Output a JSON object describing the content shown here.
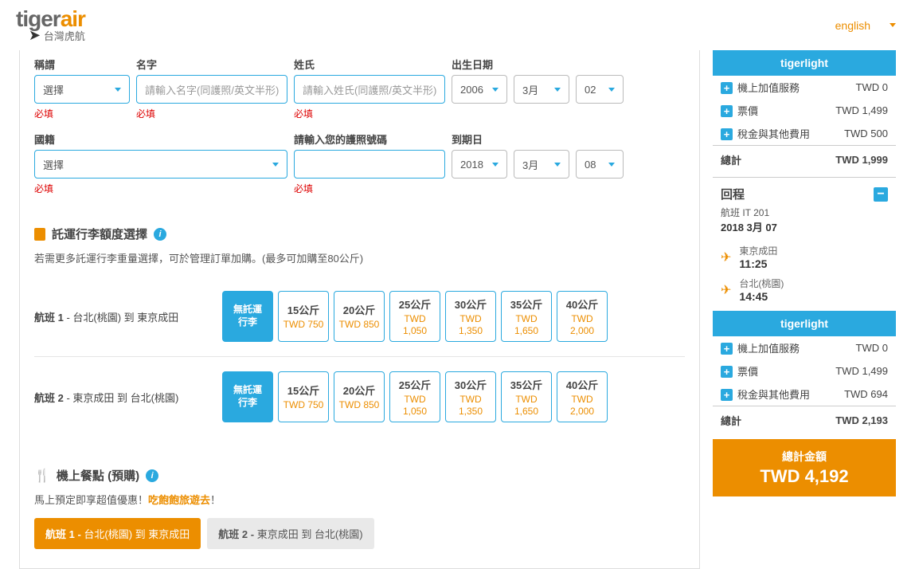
{
  "header": {
    "brand_main_1": "tiger",
    "brand_main_2": "air",
    "brand_sub": "台灣虎航",
    "lang": "english"
  },
  "form": {
    "title_label": "稱謂",
    "title_value": "選擇",
    "first_label": "名字",
    "first_ph": "請輸入名字(同護照/英文半形)",
    "last_label": "姓氏",
    "last_ph": "請輸入姓氏(同護照/英文半形)",
    "dob_label": "出生日期",
    "dob_y": "2006",
    "dob_m": "3月",
    "dob_d": "02",
    "nat_label": "國籍",
    "nat_value": "選擇",
    "pass_label": "請輸入您的護照號碼",
    "exp_label": "到期日",
    "exp_y": "2018",
    "exp_m": "3月",
    "exp_d": "08",
    "required": "必填"
  },
  "baggage": {
    "heading": "託運行李額度選擇",
    "note": "若需更多託運行李重量選擇，可於管理訂單加購。(最多可加購至80公斤)",
    "leg1_prefix": "航班 1",
    "leg1_route": " - 台北(桃園) 到 東京成田",
    "leg2_prefix": "航班 2",
    "leg2_route": " - 東京成田 到 台北(桃園)",
    "none": "無託運行李",
    "opts": [
      {
        "kg": "15公斤",
        "price": "TWD 750"
      },
      {
        "kg": "20公斤",
        "price": "TWD 850"
      },
      {
        "kg": "25公斤",
        "price": "TWD 1,050"
      },
      {
        "kg": "30公斤",
        "price": "TWD 1,350"
      },
      {
        "kg": "35公斤",
        "price": "TWD 1,650"
      },
      {
        "kg": "40公斤",
        "price": "TWD 2,000"
      }
    ]
  },
  "meals": {
    "heading": "機上餐點 (預購)",
    "note_a": "馬上預定即享超值優惠！",
    "note_b": "吃飽飽旅遊去",
    "note_c": "！",
    "tab1_prefix": "航班 1 - ",
    "tab1_route": "台北(桃園) 到 東京成田",
    "tab2_prefix": "航班 2 - ",
    "tab2_route": "東京成田 到 台北(桃園)"
  },
  "summary1": {
    "band": "tigerlight",
    "rows": [
      {
        "label": "機上加值服務",
        "value": "TWD 0"
      },
      {
        "label": "票價",
        "value": "TWD 1,499"
      },
      {
        "label": "稅金與其他費用",
        "value": "TWD 500"
      }
    ],
    "total_label": "總計",
    "total_value": "TWD 1,999"
  },
  "return": {
    "title": "回程",
    "flight": "航班 IT 201",
    "date": "2018 3月 07",
    "dep_city": "東京成田",
    "dep_time": "11:25",
    "arr_city": "台北(桃園)",
    "arr_time": "14:45"
  },
  "summary2": {
    "band": "tigerlight",
    "rows": [
      {
        "label": "機上加值服務",
        "value": "TWD 0"
      },
      {
        "label": "票價",
        "value": "TWD 1,499"
      },
      {
        "label": "稅金與其他費用",
        "value": "TWD 694"
      }
    ],
    "total_label": "總計",
    "total_value": "TWD 2,193"
  },
  "grand": {
    "label": "總計金額",
    "value": "TWD 4,192"
  }
}
